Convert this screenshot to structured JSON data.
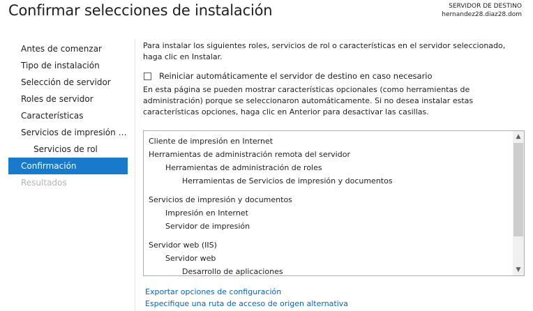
{
  "header": {
    "title": "Confirmar selecciones de instalación",
    "server_label": "SERVIDOR DE DESTINO",
    "server_name": "hernandez28.diaz28.dom"
  },
  "nav": {
    "items": [
      {
        "label": "Antes de comenzar",
        "state": "normal"
      },
      {
        "label": "Tipo de instalación",
        "state": "normal"
      },
      {
        "label": "Selección de servidor",
        "state": "normal"
      },
      {
        "label": "Roles de servidor",
        "state": "normal"
      },
      {
        "label": "Características",
        "state": "normal"
      },
      {
        "label": "Servicios de impresión y...",
        "state": "normal"
      },
      {
        "label": "Servicios de rol",
        "state": "normal",
        "sub": true
      },
      {
        "label": "Confirmación",
        "state": "active"
      },
      {
        "label": "Resultados",
        "state": "disabled"
      }
    ]
  },
  "main": {
    "intro": "Para instalar los siguientes roles, servicios de rol o características en el servidor seleccionado, haga clic en Instalar.",
    "restart_checkbox": {
      "label": "Reiniciar automáticamente el servidor de destino en caso necesario",
      "checked": false
    },
    "optional_note": "En esta página se pueden mostrar características opcionales (como herramientas de administración) porque se seleccionaron automáticamente. Si no desea instalar estas características opciones, haga clic en Anterior para desactivar las casillas.",
    "selection_list": [
      {
        "text": "Cliente de impresión en Internet",
        "level": 1
      },
      {
        "text": "Herramientas de administración remota del servidor",
        "level": 1
      },
      {
        "text": "Herramientas de administración de roles",
        "level": 2
      },
      {
        "text": "Herramientas de Servicios de impresión y documentos",
        "level": 3
      },
      {
        "text": "Servicios de impresión y documentos",
        "level": 1,
        "gap": true
      },
      {
        "text": "Impresión en Internet",
        "level": 2
      },
      {
        "text": "Servidor de impresión",
        "level": 2
      },
      {
        "text": "Servidor web (IIS)",
        "level": 1,
        "gap": true
      },
      {
        "text": "Servidor web",
        "level": 2
      },
      {
        "text": "Desarrollo de aplicaciones",
        "level": 3
      }
    ],
    "links": {
      "export": "Exportar opciones de configuración",
      "alt_source": "Especifique una ruta de acceso de origen alternativa"
    }
  },
  "colors": {
    "accent": "#1979ca",
    "link": "#0066cc",
    "disabled": "#b4b4b4"
  }
}
